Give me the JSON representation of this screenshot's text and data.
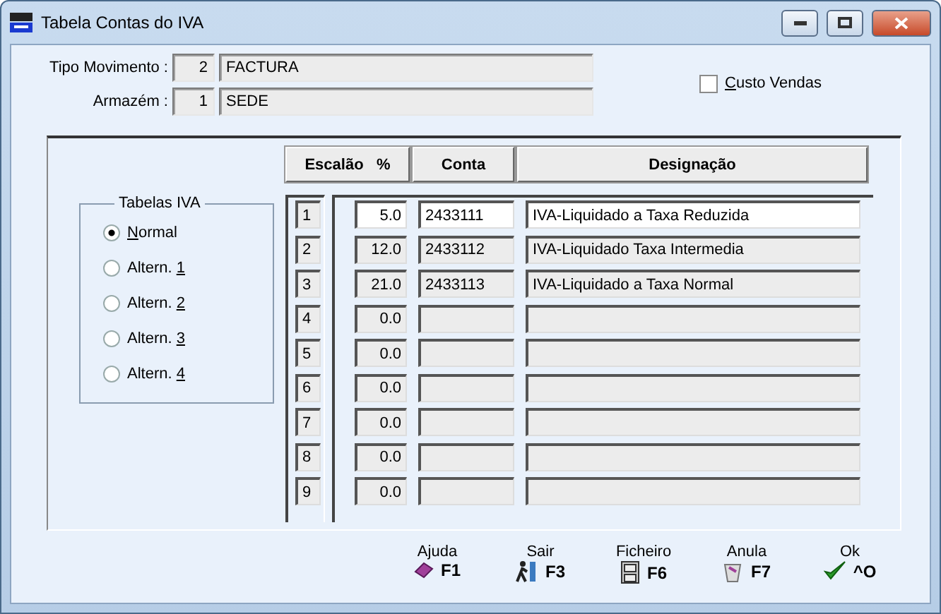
{
  "window": {
    "title": "Tabela Contas do IVA"
  },
  "header": {
    "fields": [
      {
        "label": "Tipo Movimento :",
        "code": "2",
        "value": "FACTURA"
      },
      {
        "label": "Armazém :",
        "code": "1",
        "value": "SEDE"
      }
    ],
    "custo_vendas": {
      "key": "C",
      "post": "usto Vendas",
      "checked": false
    }
  },
  "tabelas_iva": {
    "title": "Tabelas IVA",
    "options": [
      {
        "key": "N",
        "post": "ormal",
        "selected": true
      },
      {
        "pre": "Altern. ",
        "key": "1",
        "selected": false
      },
      {
        "pre": "Altern. ",
        "key": "2",
        "selected": false
      },
      {
        "pre": "Altern. ",
        "key": "3",
        "selected": false
      },
      {
        "pre": "Altern. ",
        "key": "4",
        "selected": false
      }
    ]
  },
  "table": {
    "columns": [
      "Escalão   %",
      "Conta",
      "Designação"
    ],
    "rows": [
      {
        "escalao": "1",
        "percent": "5.0",
        "conta": "2433111",
        "designacao": "IVA-Liquidado a Taxa Reduzida",
        "selected": true
      },
      {
        "escalao": "2",
        "percent": "12.0",
        "conta": "2433112",
        "designacao": "IVA-Liquidado Taxa Intermedia",
        "selected": false
      },
      {
        "escalao": "3",
        "percent": "21.0",
        "conta": "2433113",
        "designacao": "IVA-Liquidado a Taxa Normal",
        "selected": false
      },
      {
        "escalao": "4",
        "percent": "0.0",
        "conta": "",
        "designacao": "",
        "selected": false
      },
      {
        "escalao": "5",
        "percent": "0.0",
        "conta": "",
        "designacao": "",
        "selected": false
      },
      {
        "escalao": "6",
        "percent": "0.0",
        "conta": "",
        "designacao": "",
        "selected": false
      },
      {
        "escalao": "7",
        "percent": "0.0",
        "conta": "",
        "designacao": "",
        "selected": false
      },
      {
        "escalao": "8",
        "percent": "0.0",
        "conta": "",
        "designacao": "",
        "selected": false
      },
      {
        "escalao": "9",
        "percent": "0.0",
        "conta": "",
        "designacao": "",
        "selected": false
      }
    ]
  },
  "buttons": [
    {
      "label": "Ajuda",
      "key": "F1",
      "kind": "help"
    },
    {
      "label": "Sair",
      "key": "F3",
      "kind": "exit"
    },
    {
      "label": "Ficheiro",
      "key": "F6",
      "kind": "file"
    },
    {
      "label": "Anula",
      "key": "F7",
      "kind": "cancel"
    },
    {
      "label": "Ok",
      "key": "^O",
      "kind": "ok"
    }
  ]
}
